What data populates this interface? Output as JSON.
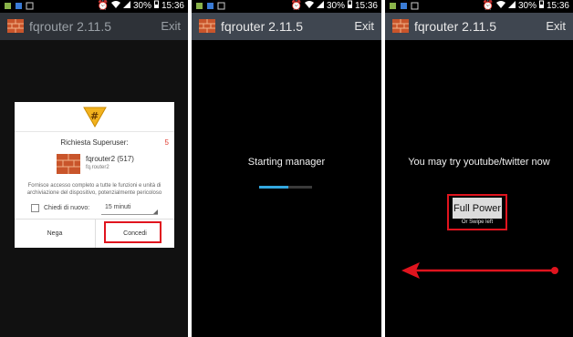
{
  "statusbar": {
    "battery": "30%",
    "time": "15:36"
  },
  "app": {
    "title": "fqrouter 2.11.5",
    "exit_label": "Exit"
  },
  "superuser_dialog": {
    "title": "Richiesta Superuser:",
    "countdown": "5",
    "app_name": "fqrouter2 (517)",
    "app_package": "fq.router2",
    "description": "Fornisce accesso completo a tutte le funzioni e unità di archiviazione del dispositivo, potenzialmente pericoloso",
    "remember_label": "Chiedi di nuovo:",
    "remember_value": "15 minuti",
    "deny_label": "Nega",
    "allow_label": "Concedi"
  },
  "panel2": {
    "status_text": "Starting manager",
    "progress": 0.55
  },
  "panel3": {
    "message": "You may try youtube/twitter now",
    "button_label": "Full Power",
    "button_sub": "Or Swipe left"
  },
  "colors": {
    "actionbar": "#3f4650",
    "highlight": "#e0141e",
    "progress": "#33a8e0"
  }
}
